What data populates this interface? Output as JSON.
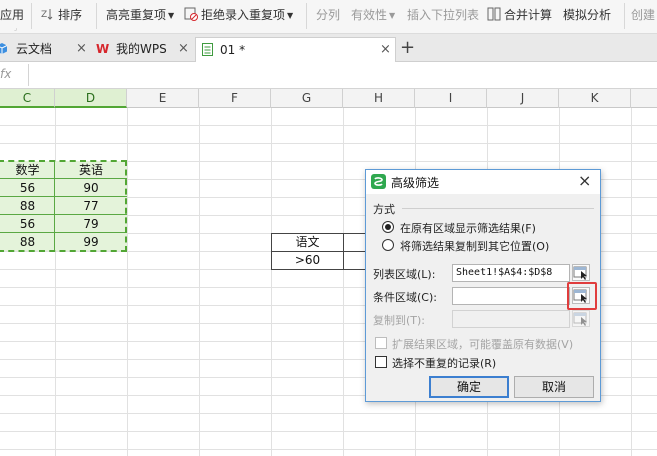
{
  "toolbar": {
    "apply": "应用",
    "sort": "排序",
    "highlight_dup": "高亮重复项",
    "reject_dup": "拒绝录入重复项",
    "split": "分列",
    "validity": "有效性",
    "insert_dropdown": "插入下拉列表",
    "merge_calc": "合并计算",
    "simulate": "模拟分析",
    "create": "创建"
  },
  "tabs": [
    {
      "label": "云文档"
    },
    {
      "label": "我的WPS"
    },
    {
      "label": "01 *"
    }
  ],
  "new_tab_symbol": "+",
  "close_symbol": "×",
  "formula_bar": {
    "fx": "fx"
  },
  "columns": [
    "C",
    "D",
    "E",
    "F",
    "G",
    "H",
    "I",
    "J",
    "K"
  ],
  "table": {
    "headers": [
      "数学",
      "英语"
    ],
    "rows": [
      [
        "56",
        "90"
      ],
      [
        "88",
        "77"
      ],
      [
        "56",
        "79"
      ],
      [
        "88",
        "99"
      ]
    ]
  },
  "criteria": {
    "header": "语文",
    "value": ">60"
  },
  "dialog": {
    "title": "高级筛选",
    "close": "×",
    "mode_label": "方式",
    "option_inplace": "在原有区域显示筛选结果(F)",
    "option_copy": "将筛选结果复制到其它位置(O)",
    "list_range_label": "列表区域(L):",
    "list_range_value": "Sheet1!$A$4:$D$8",
    "criteria_range_label": "条件区域(C):",
    "criteria_range_value": "",
    "copy_to_label": "复制到(T):",
    "expand_label": "扩展结果区域，可能覆盖原有数据(V)",
    "unique_label": "选择不重复的记录(R)",
    "ok": "确定",
    "cancel": "取消"
  },
  "colors": {
    "selection_green": "#52a634",
    "selection_fill": "#e4f3da",
    "highlight_red": "#e03c3c",
    "dialog_border": "#5d9ad6",
    "wps_red": "#d6262c"
  }
}
